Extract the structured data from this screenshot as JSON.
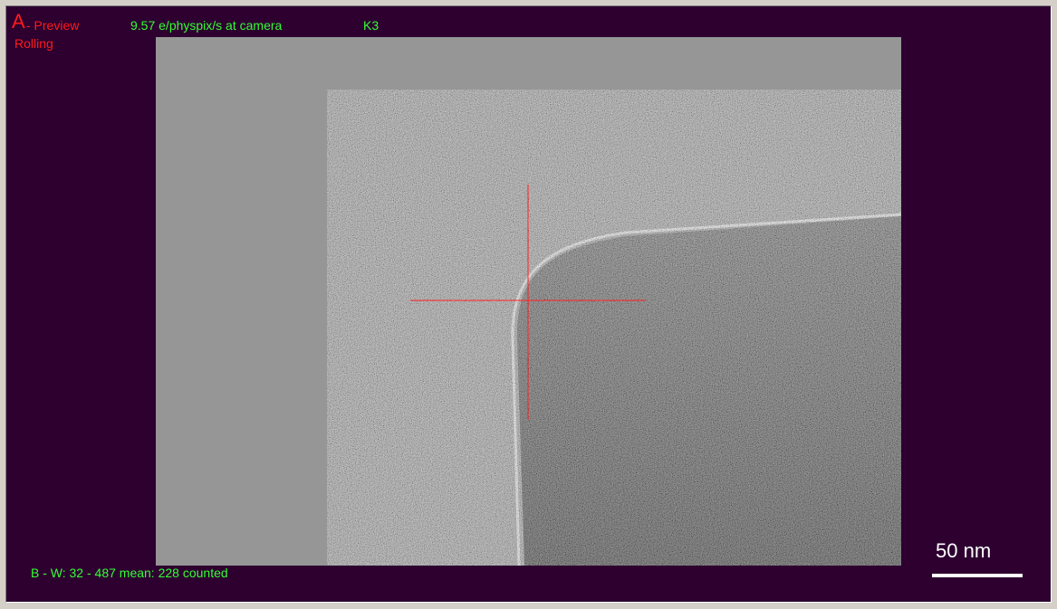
{
  "overlay": {
    "buffer_letter": "A",
    "buffer_label": "- Preview",
    "mode": "Rolling",
    "dose_rate": "9.57 e/physpix/s at camera",
    "camera": "K3",
    "stats": "B - W: 32 - 487  mean: 228  counted",
    "scale_bar_label": "50 nm"
  },
  "colors": {
    "background": "#2d0030",
    "padding_gray": "#969696",
    "status_red": "#ff1a1a",
    "info_green": "#33ff33",
    "crosshair": "#ff2020",
    "scale_bar": "#ffffff"
  },
  "icons": {
    "crosshair": "crosshair-icon"
  }
}
